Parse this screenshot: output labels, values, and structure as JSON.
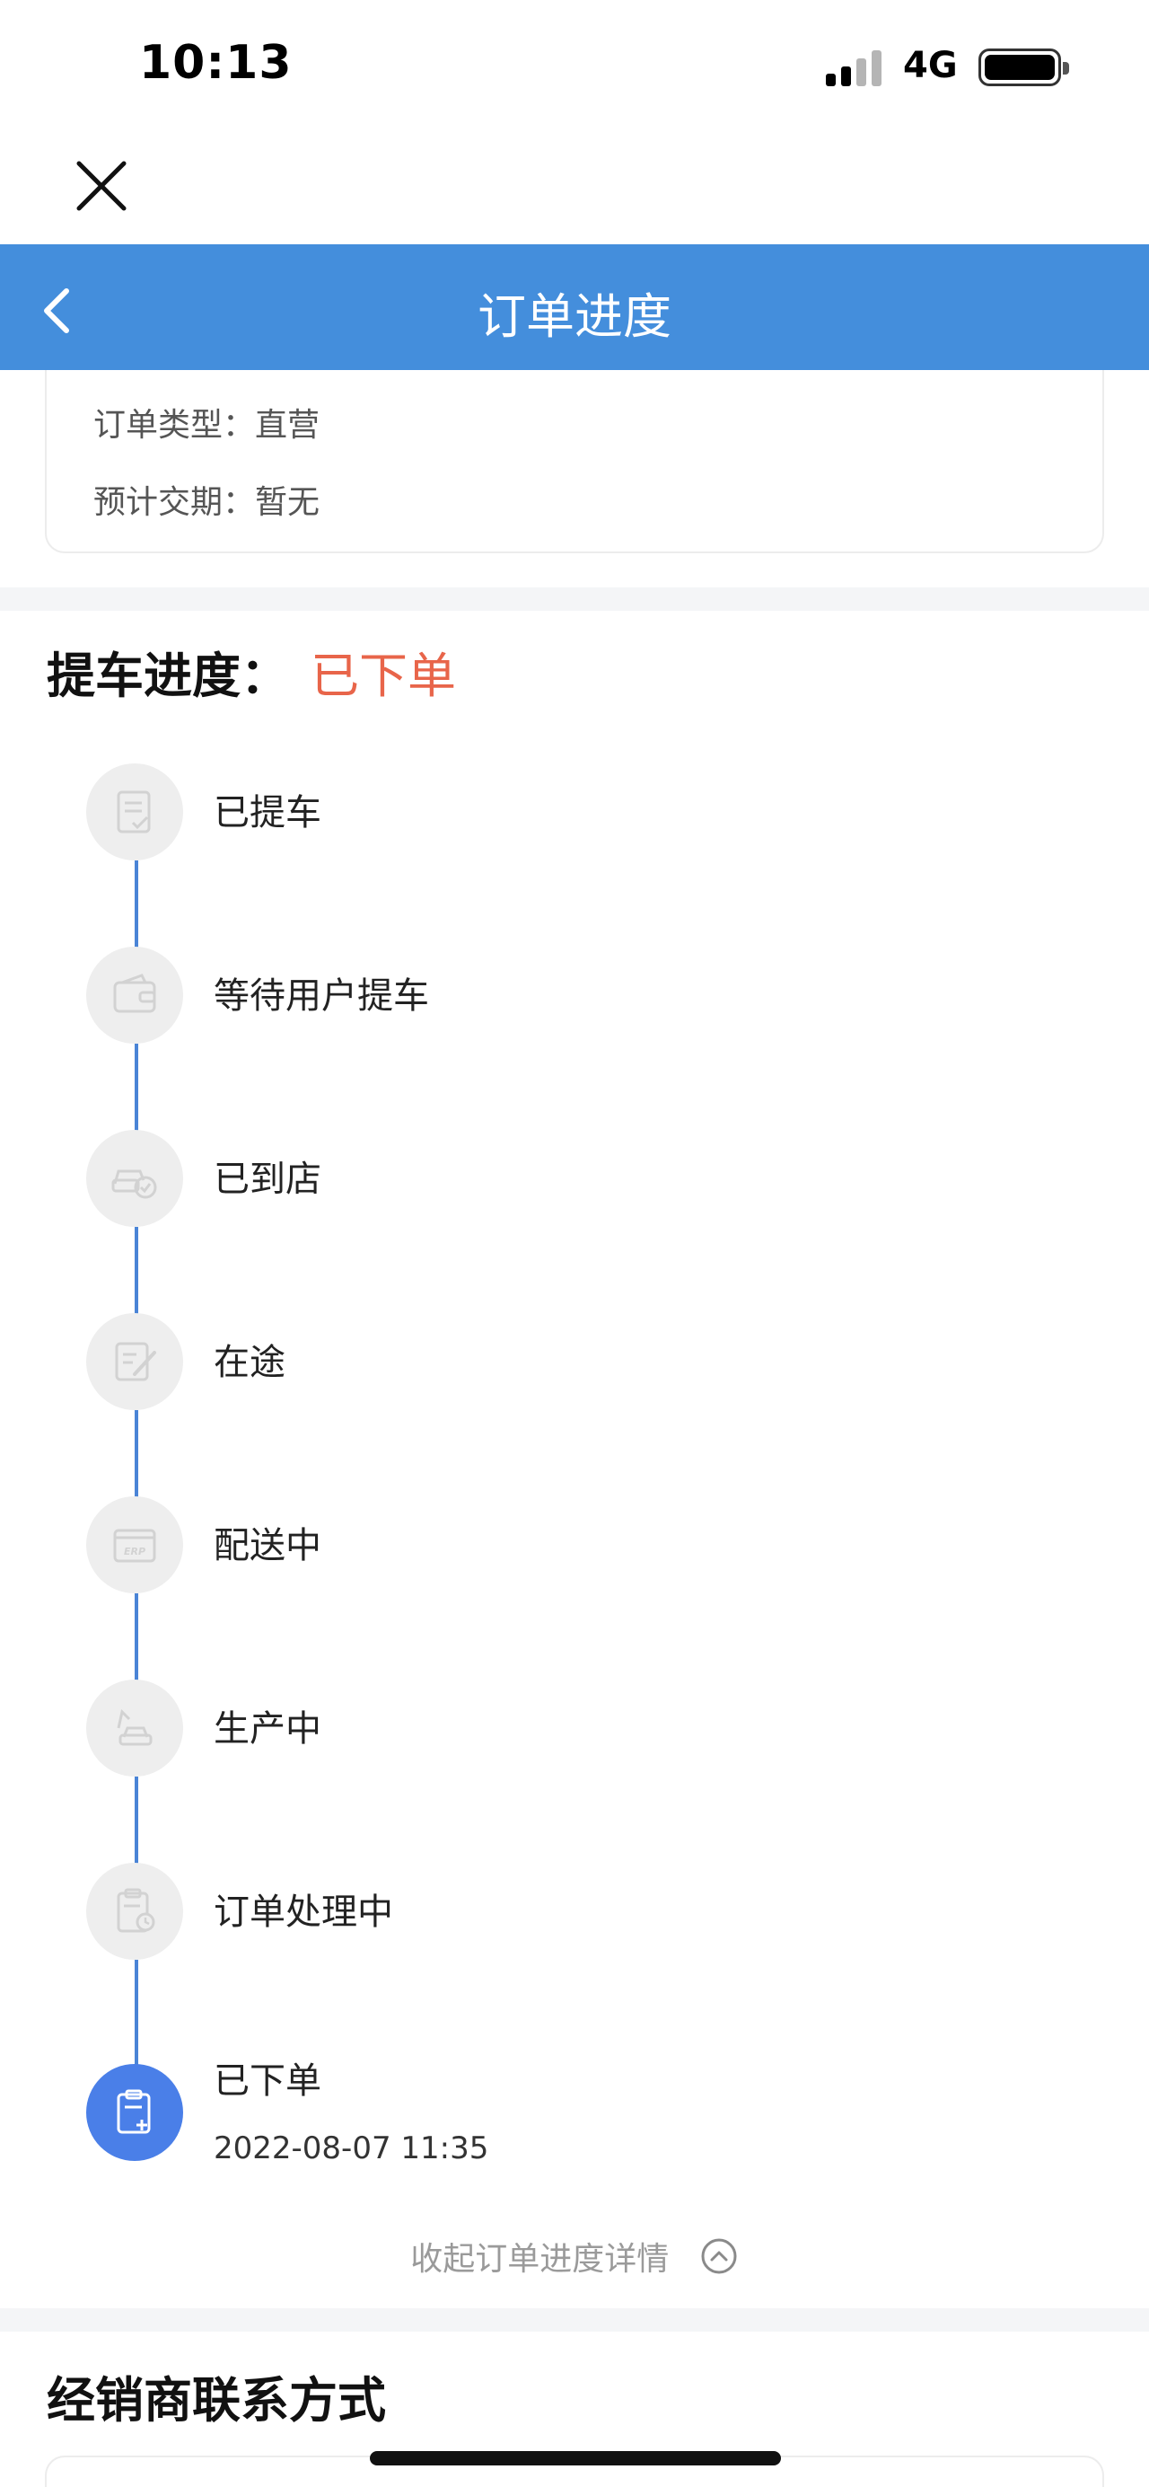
{
  "status_bar": {
    "time": "10:13",
    "network": "4G",
    "signal_bars_filled": 2,
    "signal_bars_total": 4,
    "battery_icon": "battery-full-icon"
  },
  "top": {
    "close_icon": "close-icon"
  },
  "navbar": {
    "title": "订单进度",
    "back_icon": "chevron-left-icon",
    "background_color": "#448EDC"
  },
  "order_info": {
    "type_label": "订单类型：",
    "type_value": "直营",
    "delivery_label": "预计交期：",
    "delivery_value": "暂无"
  },
  "progress": {
    "title": "提车进度：",
    "current_status": "已下单",
    "status_color": "#E8654A",
    "steps": [
      {
        "label": "已提车",
        "icon": "checklist-icon",
        "active": false
      },
      {
        "label": "等待用户提车",
        "icon": "wallet-icon",
        "active": false
      },
      {
        "label": "已到店",
        "icon": "car-check-icon",
        "active": false
      },
      {
        "label": "在途",
        "icon": "edit-document-icon",
        "active": false
      },
      {
        "label": "配送中",
        "icon": "erp-box-icon",
        "active": false
      },
      {
        "label": "生产中",
        "icon": "robot-arm-car-icon",
        "active": false
      },
      {
        "label": "订单处理中",
        "icon": "clipboard-clock-icon",
        "active": false
      },
      {
        "label": "已下单",
        "icon": "clipboard-plus-icon",
        "active": true,
        "time": "2022-08-07 11:35"
      }
    ],
    "collapse_label": "收起订单进度详情",
    "collapse_icon": "chevron-up-circle-icon"
  },
  "dealer": {
    "title": "经销商联系方式"
  }
}
